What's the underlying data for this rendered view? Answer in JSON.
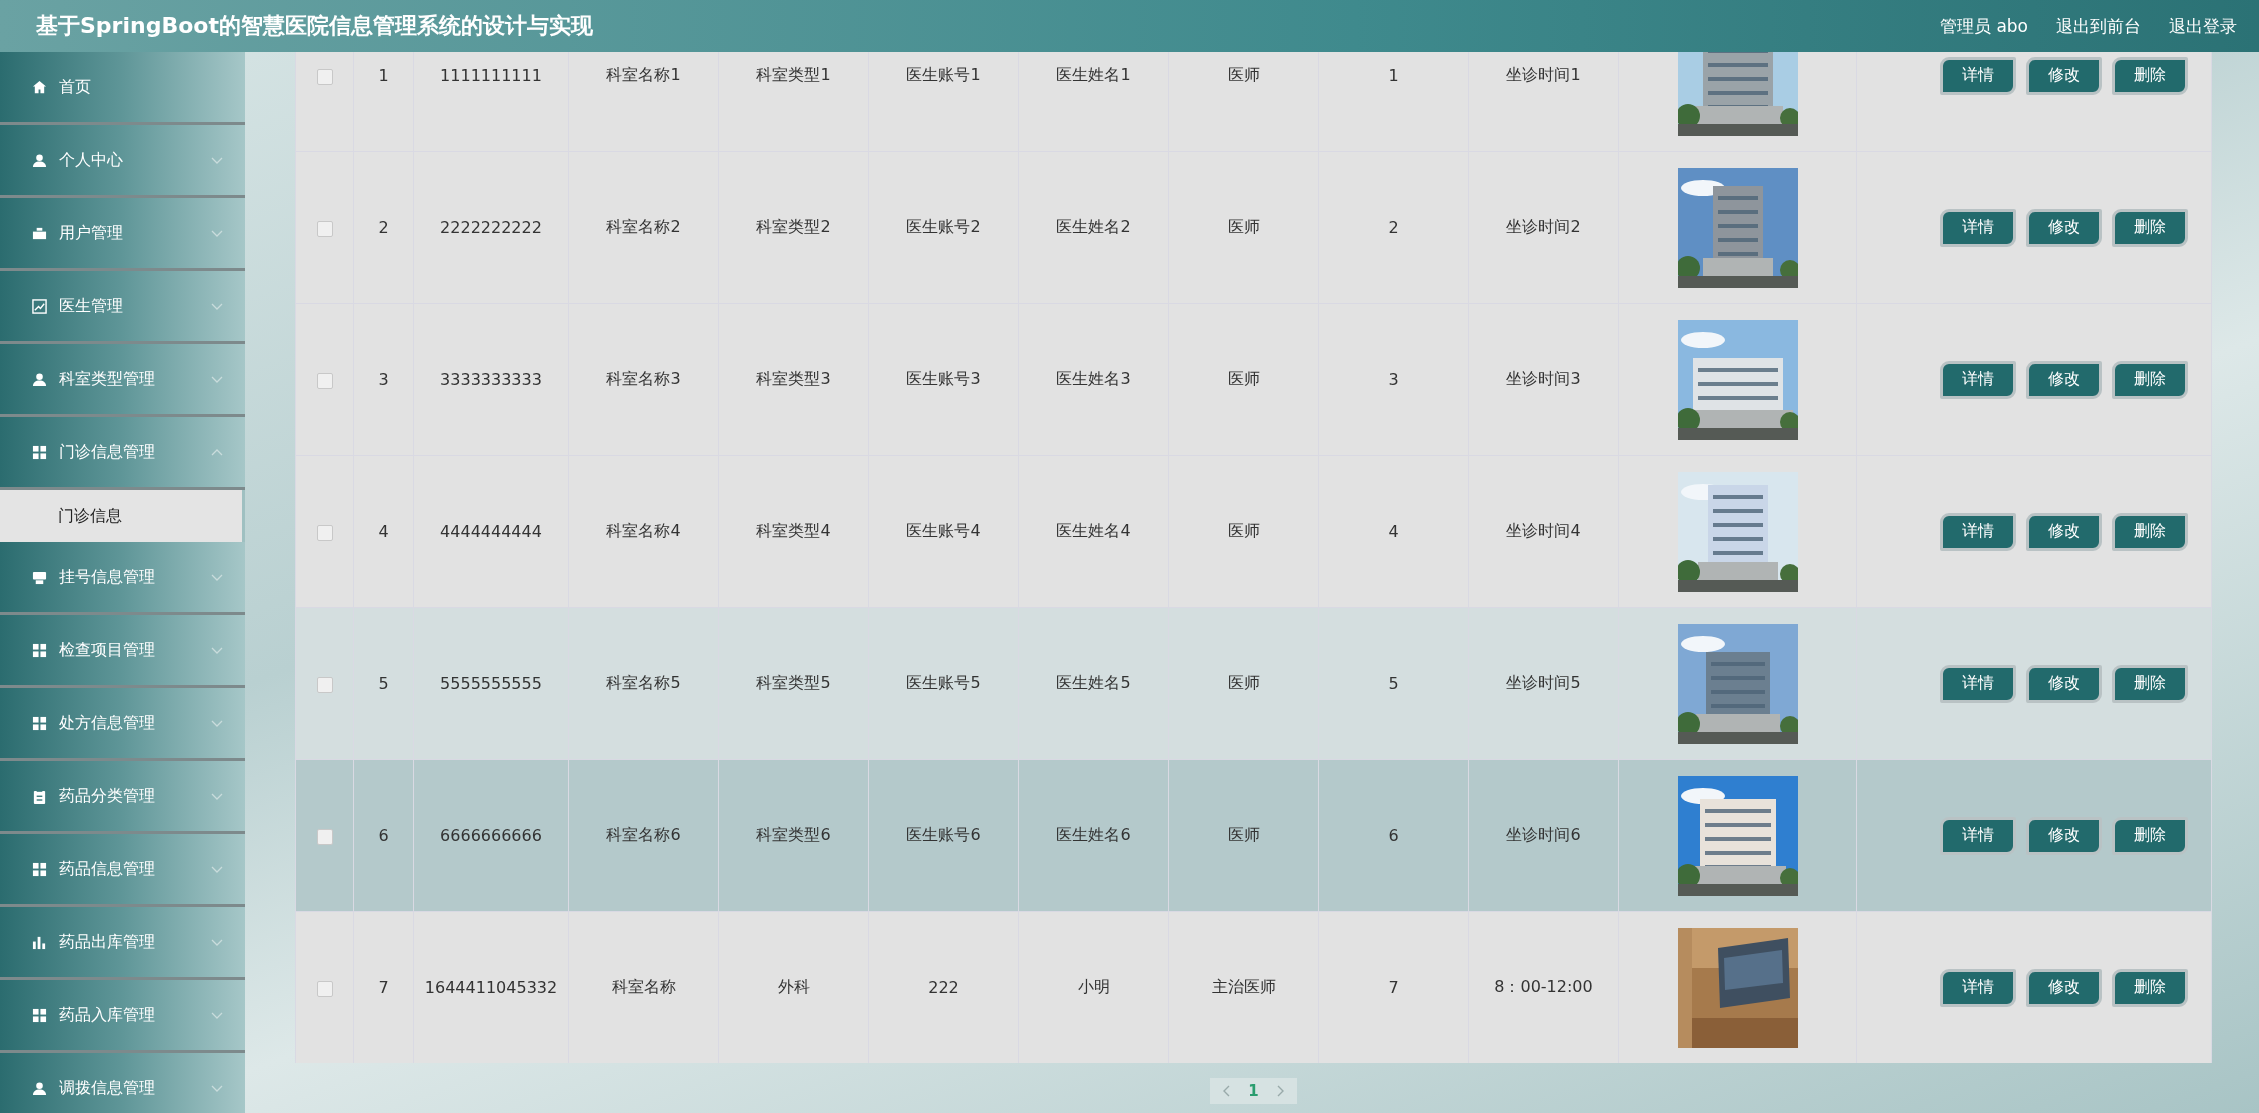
{
  "header": {
    "title": "基于SpringBoot的智慧医院信息管理系统的设计与实现",
    "links": [
      "管理员 abo",
      "退出到前台",
      "退出登录"
    ]
  },
  "sidebar": {
    "items": [
      {
        "label": "首页"
      },
      {
        "label": "个人中心",
        "expanded": false
      },
      {
        "label": "用户管理",
        "expanded": false
      },
      {
        "label": "医生管理",
        "expanded": false
      },
      {
        "label": "科室类型管理",
        "expanded": false
      },
      {
        "label": "门诊信息管理",
        "expanded": true,
        "children": [
          {
            "label": "门诊信息",
            "selected": true
          }
        ]
      },
      {
        "label": "挂号信息管理",
        "expanded": false
      },
      {
        "label": "检查项目管理",
        "expanded": false
      },
      {
        "label": "处方信息管理",
        "expanded": false
      },
      {
        "label": "药品分类管理",
        "expanded": false
      },
      {
        "label": "药品信息管理",
        "expanded": false
      },
      {
        "label": "药品出库管理",
        "expanded": false
      },
      {
        "label": "药品入库管理",
        "expanded": false
      },
      {
        "label": "调拨信息管理",
        "expanded": false
      }
    ]
  },
  "table": {
    "rows": [
      {
        "checked": false,
        "hovered": false,
        "selected": false,
        "cells": [
          "1",
          "1111111111",
          "科室名称1",
          "科室类型1",
          "医生账号1",
          "医生姓名1",
          "医师",
          "1",
          "坐诊时间1"
        ],
        "actions": [
          "详情",
          "修改",
          "删除"
        ]
      },
      {
        "checked": false,
        "hovered": false,
        "selected": false,
        "cells": [
          "2",
          "2222222222",
          "科室名称2",
          "科室类型2",
          "医生账号2",
          "医生姓名2",
          "医师",
          "2",
          "坐诊时间2"
        ],
        "actions": [
          "详情",
          "修改",
          "删除"
        ]
      },
      {
        "checked": false,
        "hovered": false,
        "selected": false,
        "cells": [
          "3",
          "3333333333",
          "科室名称3",
          "科室类型3",
          "医生账号3",
          "医生姓名3",
          "医师",
          "3",
          "坐诊时间3"
        ],
        "actions": [
          "详情",
          "修改",
          "删除"
        ]
      },
      {
        "checked": false,
        "hovered": false,
        "selected": false,
        "cells": [
          "4",
          "4444444444",
          "科室名称4",
          "科室类型4",
          "医生账号4",
          "医生姓名4",
          "医师",
          "4",
          "坐诊时间4"
        ],
        "actions": [
          "详情",
          "修改",
          "删除"
        ]
      },
      {
        "checked": false,
        "hovered": true,
        "selected": false,
        "cells": [
          "5",
          "5555555555",
          "科室名称5",
          "科室类型5",
          "医生账号5",
          "医生姓名5",
          "医师",
          "5",
          "坐诊时间5"
        ],
        "actions": [
          "详情",
          "修改",
          "删除"
        ]
      },
      {
        "checked": false,
        "hovered": false,
        "selected": true,
        "cells": [
          "6",
          "6666666666",
          "科室名称6",
          "科室类型6",
          "医生账号6",
          "医生姓名6",
          "医师",
          "6",
          "坐诊时间6"
        ],
        "actions": [
          "详情",
          "修改",
          "删除"
        ]
      },
      {
        "checked": false,
        "hovered": false,
        "selected": false,
        "cells": [
          "7",
          "1644411045332",
          "科室名称",
          "外科",
          "222",
          "小明",
          "主治医师",
          "7",
          "8：00-12:00"
        ],
        "actions": [
          "详情",
          "修改",
          "删除"
        ]
      }
    ]
  },
  "pagination": {
    "pages": [
      {
        "label": "1",
        "selected": true
      }
    ]
  }
}
